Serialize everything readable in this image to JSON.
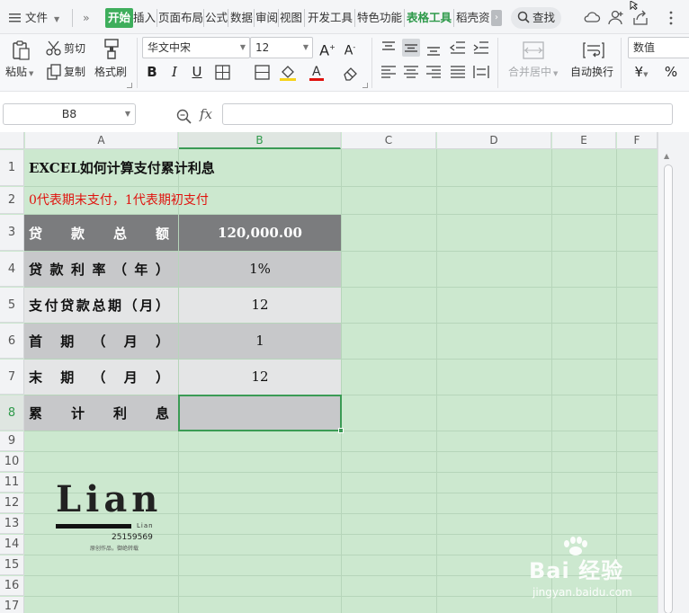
{
  "menubar": {
    "menu_label": "文件",
    "more": "»",
    "tabs": [
      "开始",
      "插入",
      "页面布局",
      "公式",
      "数据",
      "审阅",
      "视图",
      "开发工具",
      "特色功能",
      "表格工具",
      "稻壳资"
    ],
    "search_label": "查找"
  },
  "ribbon": {
    "paste": "粘贴",
    "cut": "剪切",
    "copy": "复制",
    "format_painter": "格式刷",
    "font_name": "华文中宋",
    "font_size": "12",
    "merge_center": "合并居中",
    "wrap_text": "自动换行",
    "number_format": "数值",
    "currency": "¥",
    "percent": "%",
    "bold": "B",
    "italic": "I",
    "underline": "U",
    "grow_font": "A",
    "shrink_font": "A"
  },
  "formula_bar": {
    "cell_ref": "B8",
    "fx": "fx",
    "value": ""
  },
  "sheet": {
    "columns": [
      "A",
      "B",
      "C",
      "D",
      "E",
      "F"
    ],
    "rows": [
      "1",
      "2",
      "3",
      "4",
      "5",
      "6",
      "7",
      "8",
      "9",
      "10",
      "11",
      "12",
      "13",
      "14",
      "15",
      "16",
      "17"
    ],
    "title": "EXCEL如何计算支付累计利息",
    "note": "0代表期末支付，1代表期初支付",
    "table": [
      {
        "label": [
          "贷",
          "款",
          "总",
          "额"
        ],
        "value": "120,000.00"
      },
      {
        "label": [
          "贷",
          "款",
          "利",
          "率",
          "（",
          "年",
          "）"
        ],
        "value": "1%"
      },
      {
        "label": [
          "支",
          "付",
          "贷",
          "款",
          "总",
          "期",
          "（",
          "月",
          "）"
        ],
        "value": "12"
      },
      {
        "label": [
          "首",
          "期",
          "（",
          "月",
          "）"
        ],
        "value": "1"
      },
      {
        "label": [
          "末",
          "期",
          "（",
          "月",
          "）"
        ],
        "value": "12"
      },
      {
        "label": [
          "累",
          "计",
          "利",
          "息"
        ],
        "value": ""
      }
    ]
  },
  "logo": {
    "word": "Lian",
    "small": "Lian",
    "number": "25159569",
    "caption": "原创作品，御绝转载"
  },
  "watermark": {
    "brand": "Bai 经验",
    "url": "jingyan.baidu.com"
  },
  "colors": {
    "accent": "#3eae5c",
    "grid_bg": "#cce8cf",
    "header_dark": "#7b7c7e",
    "note_red": "#e0120d"
  }
}
